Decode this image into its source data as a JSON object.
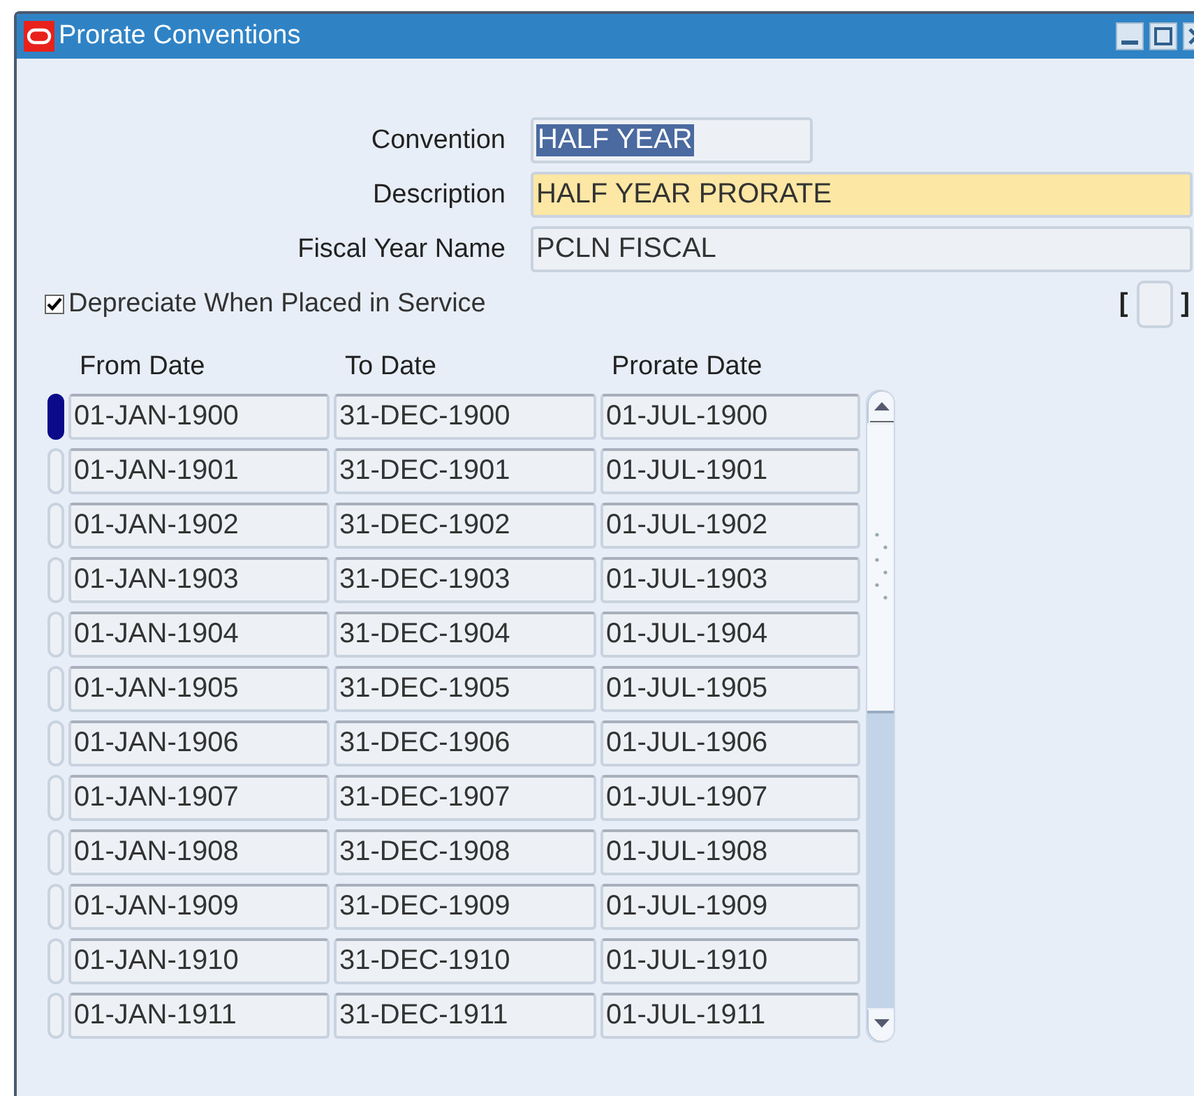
{
  "window": {
    "title": "Prorate Conventions"
  },
  "fields": [
    {
      "label": "Convention",
      "value": "HALF YEAR",
      "kind": "short",
      "selected": true
    },
    {
      "label": "Description",
      "value": "HALF YEAR PRORATE",
      "kind": "required",
      "selected": false
    },
    {
      "label": "Fiscal Year Name",
      "value": "PCLN FISCAL",
      "kind": "readonly",
      "selected": false
    }
  ],
  "checkbox": {
    "label": "Depreciate When Placed in Service",
    "checked": true
  },
  "flexfield": {
    "open": "[",
    "close": "]"
  },
  "table": {
    "columns": [
      "From Date",
      "To Date",
      "Prorate Date"
    ],
    "rows": [
      {
        "cells": [
          "01-JAN-1900",
          "31-DEC-1900",
          "01-JUL-1900"
        ],
        "selected": true
      },
      {
        "cells": [
          "01-JAN-1901",
          "31-DEC-1901",
          "01-JUL-1901"
        ],
        "selected": false
      },
      {
        "cells": [
          "01-JAN-1902",
          "31-DEC-1902",
          "01-JUL-1902"
        ],
        "selected": false
      },
      {
        "cells": [
          "01-JAN-1903",
          "31-DEC-1903",
          "01-JUL-1903"
        ],
        "selected": false
      },
      {
        "cells": [
          "01-JAN-1904",
          "31-DEC-1904",
          "01-JUL-1904"
        ],
        "selected": false
      },
      {
        "cells": [
          "01-JAN-1905",
          "31-DEC-1905",
          "01-JUL-1905"
        ],
        "selected": false
      },
      {
        "cells": [
          "01-JAN-1906",
          "31-DEC-1906",
          "01-JUL-1906"
        ],
        "selected": false
      },
      {
        "cells": [
          "01-JAN-1907",
          "31-DEC-1907",
          "01-JUL-1907"
        ],
        "selected": false
      },
      {
        "cells": [
          "01-JAN-1908",
          "31-DEC-1908",
          "01-JUL-1908"
        ],
        "selected": false
      },
      {
        "cells": [
          "01-JAN-1909",
          "31-DEC-1909",
          "01-JUL-1909"
        ],
        "selected": false
      },
      {
        "cells": [
          "01-JAN-1910",
          "31-DEC-1910",
          "01-JUL-1910"
        ],
        "selected": false
      },
      {
        "cells": [
          "01-JAN-1911",
          "31-DEC-1911",
          "01-JUL-1911"
        ],
        "selected": false
      }
    ]
  }
}
